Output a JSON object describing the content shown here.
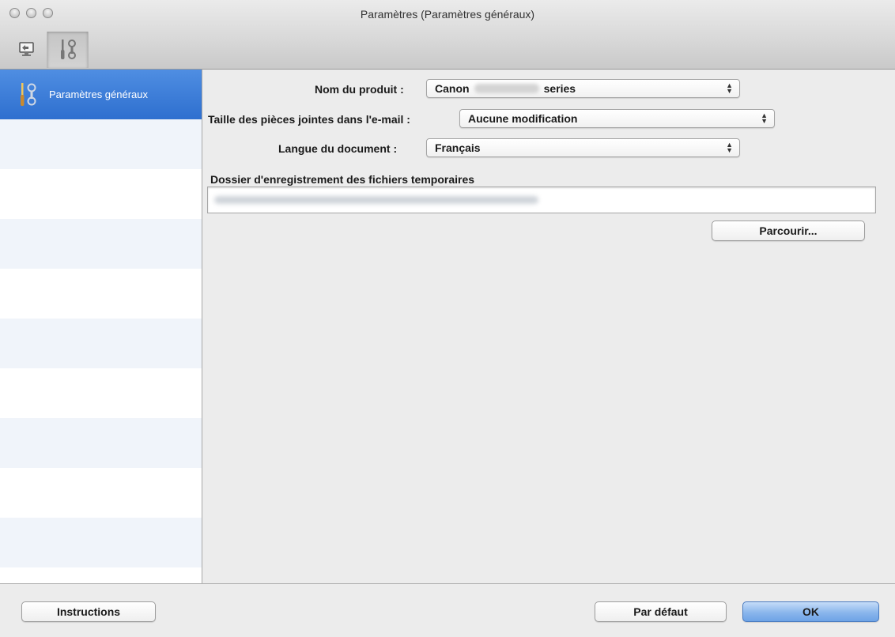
{
  "window": {
    "title": "Paramètres (Paramètres généraux)"
  },
  "toolbar": {
    "items": [
      {
        "icon": "scan-to-computer-icon"
      },
      {
        "icon": "general-settings-tools-icon",
        "active": true
      }
    ]
  },
  "sidebar": {
    "items": [
      {
        "label": "Paramètres généraux",
        "icon": "general-settings-tools-icon",
        "selected": true
      }
    ]
  },
  "form": {
    "product": {
      "label": "Nom du produit :",
      "value_prefix": "Canon",
      "value_suffix": "series"
    },
    "attachment_size": {
      "label": "Taille des pièces jointes dans l'e-mail :",
      "value": "Aucune modification"
    },
    "document_language": {
      "label": "Langue du document :",
      "value": "Français"
    },
    "temp_folder": {
      "label": "Dossier d'enregistrement des fichiers temporaires"
    },
    "browse_label": "Parcourir..."
  },
  "footer": {
    "instructions_label": "Instructions",
    "defaults_label": "Par défaut",
    "ok_label": "OK"
  },
  "colors": {
    "selection": "#2e6fcf",
    "default_button": "#6ea3e6"
  }
}
